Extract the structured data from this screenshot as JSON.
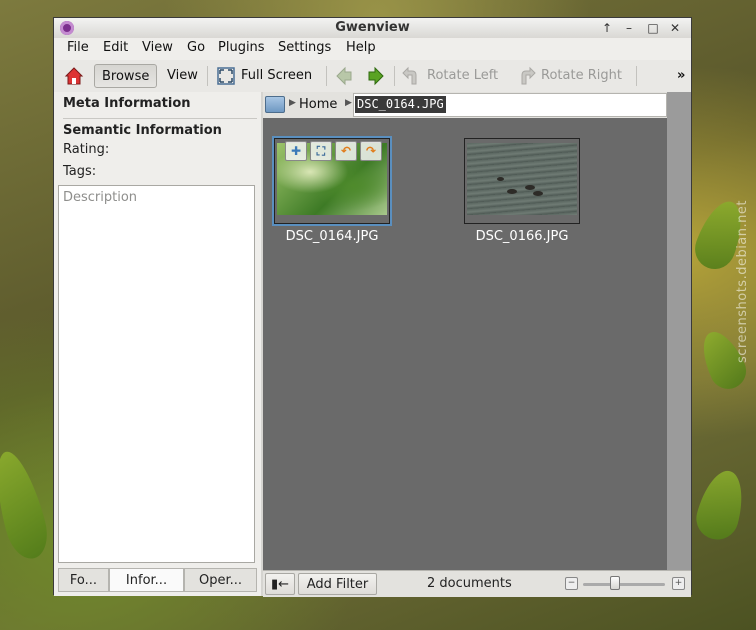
{
  "window": {
    "title": "Gwenview",
    "icons": {
      "app": "gwenview-eye-icon",
      "keep_above": "arrow-up-icon",
      "minimize": "minimize-icon",
      "maximize": "maximize-icon",
      "close": "close-icon"
    }
  },
  "menubar": {
    "items": [
      {
        "label": "File"
      },
      {
        "label": "Edit"
      },
      {
        "label": "View"
      },
      {
        "label": "Go"
      },
      {
        "label": "Plugins"
      },
      {
        "label": "Settings"
      },
      {
        "label": "Help"
      }
    ]
  },
  "toolbar": {
    "browse": "Browse",
    "view": "View",
    "fullscreen": "Full Screen",
    "rotate_left": "Rotate Left",
    "rotate_right": "Rotate Right",
    "more": "»"
  },
  "sidebar": {
    "meta_title": "Meta Information",
    "semantic_title": "Semantic Information",
    "rating_label": "Rating:",
    "tags_label": "Tags:",
    "description_placeholder": "Description",
    "tabs": [
      {
        "label": "Fo..."
      },
      {
        "label": "Infor..."
      },
      {
        "label": "Oper..."
      }
    ]
  },
  "urlbar": {
    "home": "Home",
    "path": "DSC_0164.JPG"
  },
  "thumbnails": [
    {
      "name": "DSC_0164.JPG",
      "selected": true
    },
    {
      "name": "DSC_0166.JPG",
      "selected": false
    }
  ],
  "statusbar": {
    "toggle_sidebar": "▮←",
    "add_filter": "Add Filter",
    "count": "2 documents",
    "zoom_level": 0.4
  },
  "watermark": "screenshots.debian.net",
  "colors": {
    "selection": "#5a8fbf",
    "content_bg": "#6a6a6a"
  }
}
